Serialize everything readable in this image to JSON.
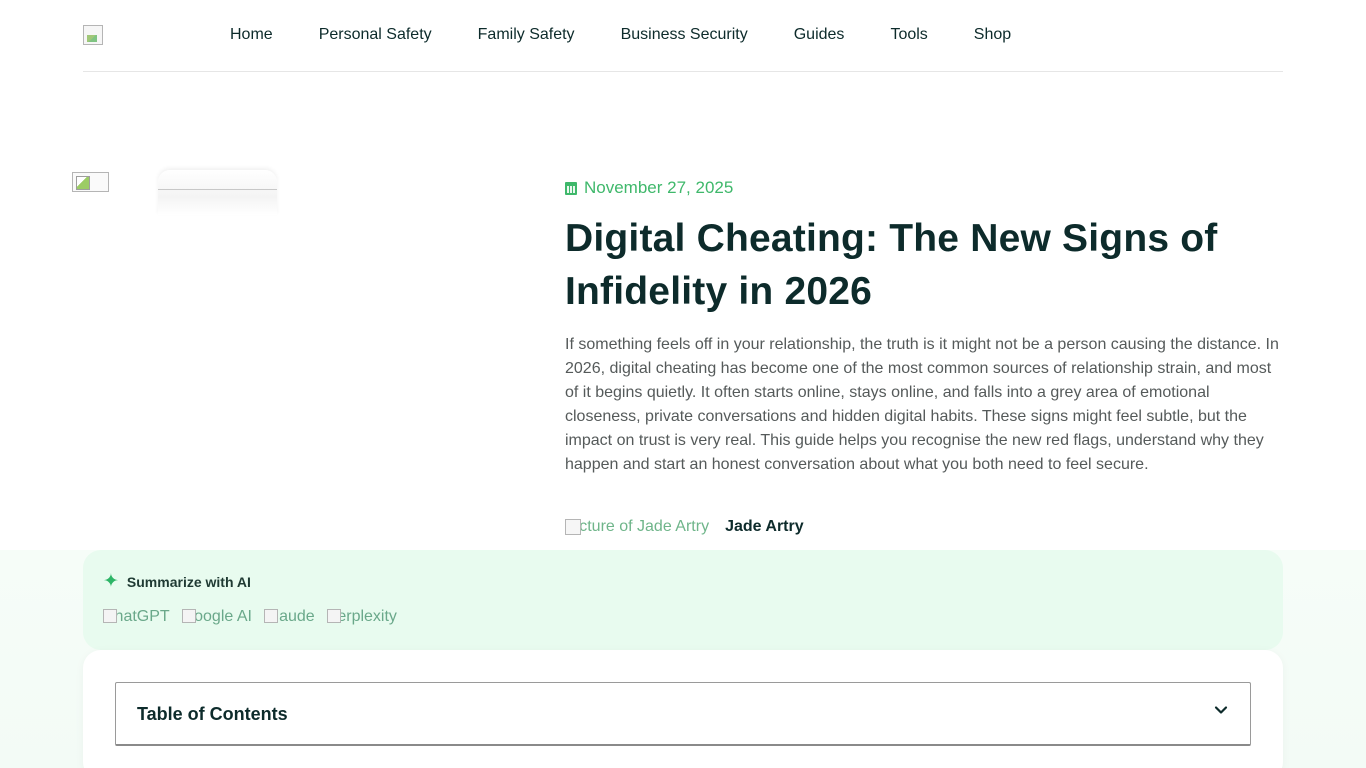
{
  "nav": {
    "items": [
      "Home",
      "Personal Safety",
      "Family Safety",
      "Business Security",
      "Guides",
      "Tools",
      "Shop"
    ]
  },
  "article": {
    "date": "November 27, 2025",
    "title": "Digital Cheating: The New Signs of Infidelity in 2026",
    "intro": "If something feels off in your relationship, the truth is it might not be a person causing the distance. In 2026, digital cheating has become one of the most common sources of relationship strain, and most of it begins quietly. It often starts online, stays online, and falls into a grey area of emotional closeness, private conversations and hidden digital habits. These signs might feel subtle, but the impact on trust is very real. This guide helps you recognise the new red flags, understand why they happen and start an honest conversation about what you both need to feel secure.",
    "author_img_alt": "Picture of Jade Artry",
    "author_name": "Jade Artry"
  },
  "summary": {
    "label": "Summarize with AI",
    "links": [
      "ChatGPT",
      "Google AI",
      "Claude",
      "Perplexity"
    ]
  },
  "toc": {
    "title": "Table of Contents"
  },
  "colors": {
    "accent": "#3fb86b",
    "heading": "#0d2b2b",
    "summary_bg": "#e8fbef"
  }
}
